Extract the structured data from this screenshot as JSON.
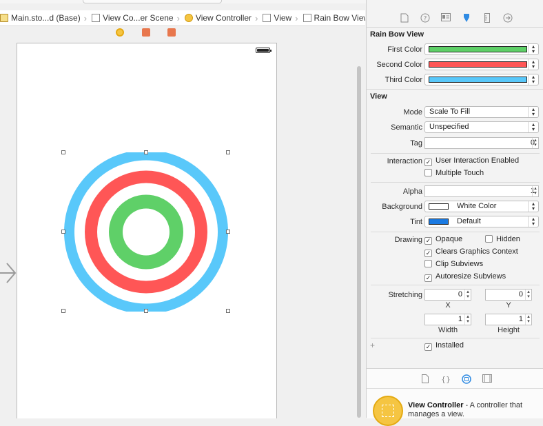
{
  "breadcrumb": {
    "items": [
      {
        "label": "Main.sto...d (Base)",
        "icon": "storyboard-file-icon"
      },
      {
        "label": "View Co...er Scene",
        "icon": "scene-icon"
      },
      {
        "label": "View Controller",
        "icon": "view-controller-icon"
      },
      {
        "label": "View",
        "icon": "view-icon"
      },
      {
        "label": "Rain Bow View",
        "icon": "view-icon"
      }
    ],
    "separator": "›"
  },
  "inspector": {
    "tabs": [
      "file-inspector-icon",
      "quick-help-icon",
      "identity-inspector-icon",
      "attributes-inspector-icon",
      "size-inspector-icon",
      "connections-inspector-icon"
    ],
    "rainbow_section": {
      "title": "Rain Bow View",
      "first_color_label": "First Color",
      "second_color_label": "Second Color",
      "third_color_label": "Third Color",
      "first_color": "#5fd068",
      "second_color": "#ff5656",
      "third_color": "#59c8fa"
    },
    "view_section": {
      "title": "View",
      "mode_label": "Mode",
      "mode_value": "Scale To Fill",
      "semantic_label": "Semantic",
      "semantic_value": "Unspecified",
      "tag_label": "Tag",
      "tag_value": "0",
      "interaction_label": "Interaction",
      "user_interaction_label": "User Interaction Enabled",
      "multiple_touch_label": "Multiple Touch",
      "alpha_label": "Alpha",
      "alpha_value": "1",
      "background_label": "Background",
      "background_value": "White Color",
      "background_color": "#ffffff",
      "tint_label": "Tint",
      "tint_value": "Default",
      "tint_color": "#1a7ae2",
      "drawing_label": "Drawing",
      "opaque_label": "Opaque",
      "hidden_label": "Hidden",
      "clears_label": "Clears Graphics Context",
      "clip_label": "Clip Subviews",
      "autoresize_label": "Autoresize Subviews",
      "stretching_label": "Stretching",
      "stretch_x": "0",
      "stretch_y": "0",
      "stretch_width": "1",
      "stretch_height": "1",
      "x_label": "X",
      "y_label": "Y",
      "width_label": "Width",
      "height_label": "Height",
      "installed_label": "Installed",
      "plus_label": "+",
      "check_mark": "✓"
    }
  },
  "library": {
    "tabs": [
      "file-template-icon",
      "code-snippet-icon",
      "object-library-icon",
      "media-library-icon"
    ],
    "item_title": "View Controller",
    "item_desc": " - A controller that manages a view."
  }
}
